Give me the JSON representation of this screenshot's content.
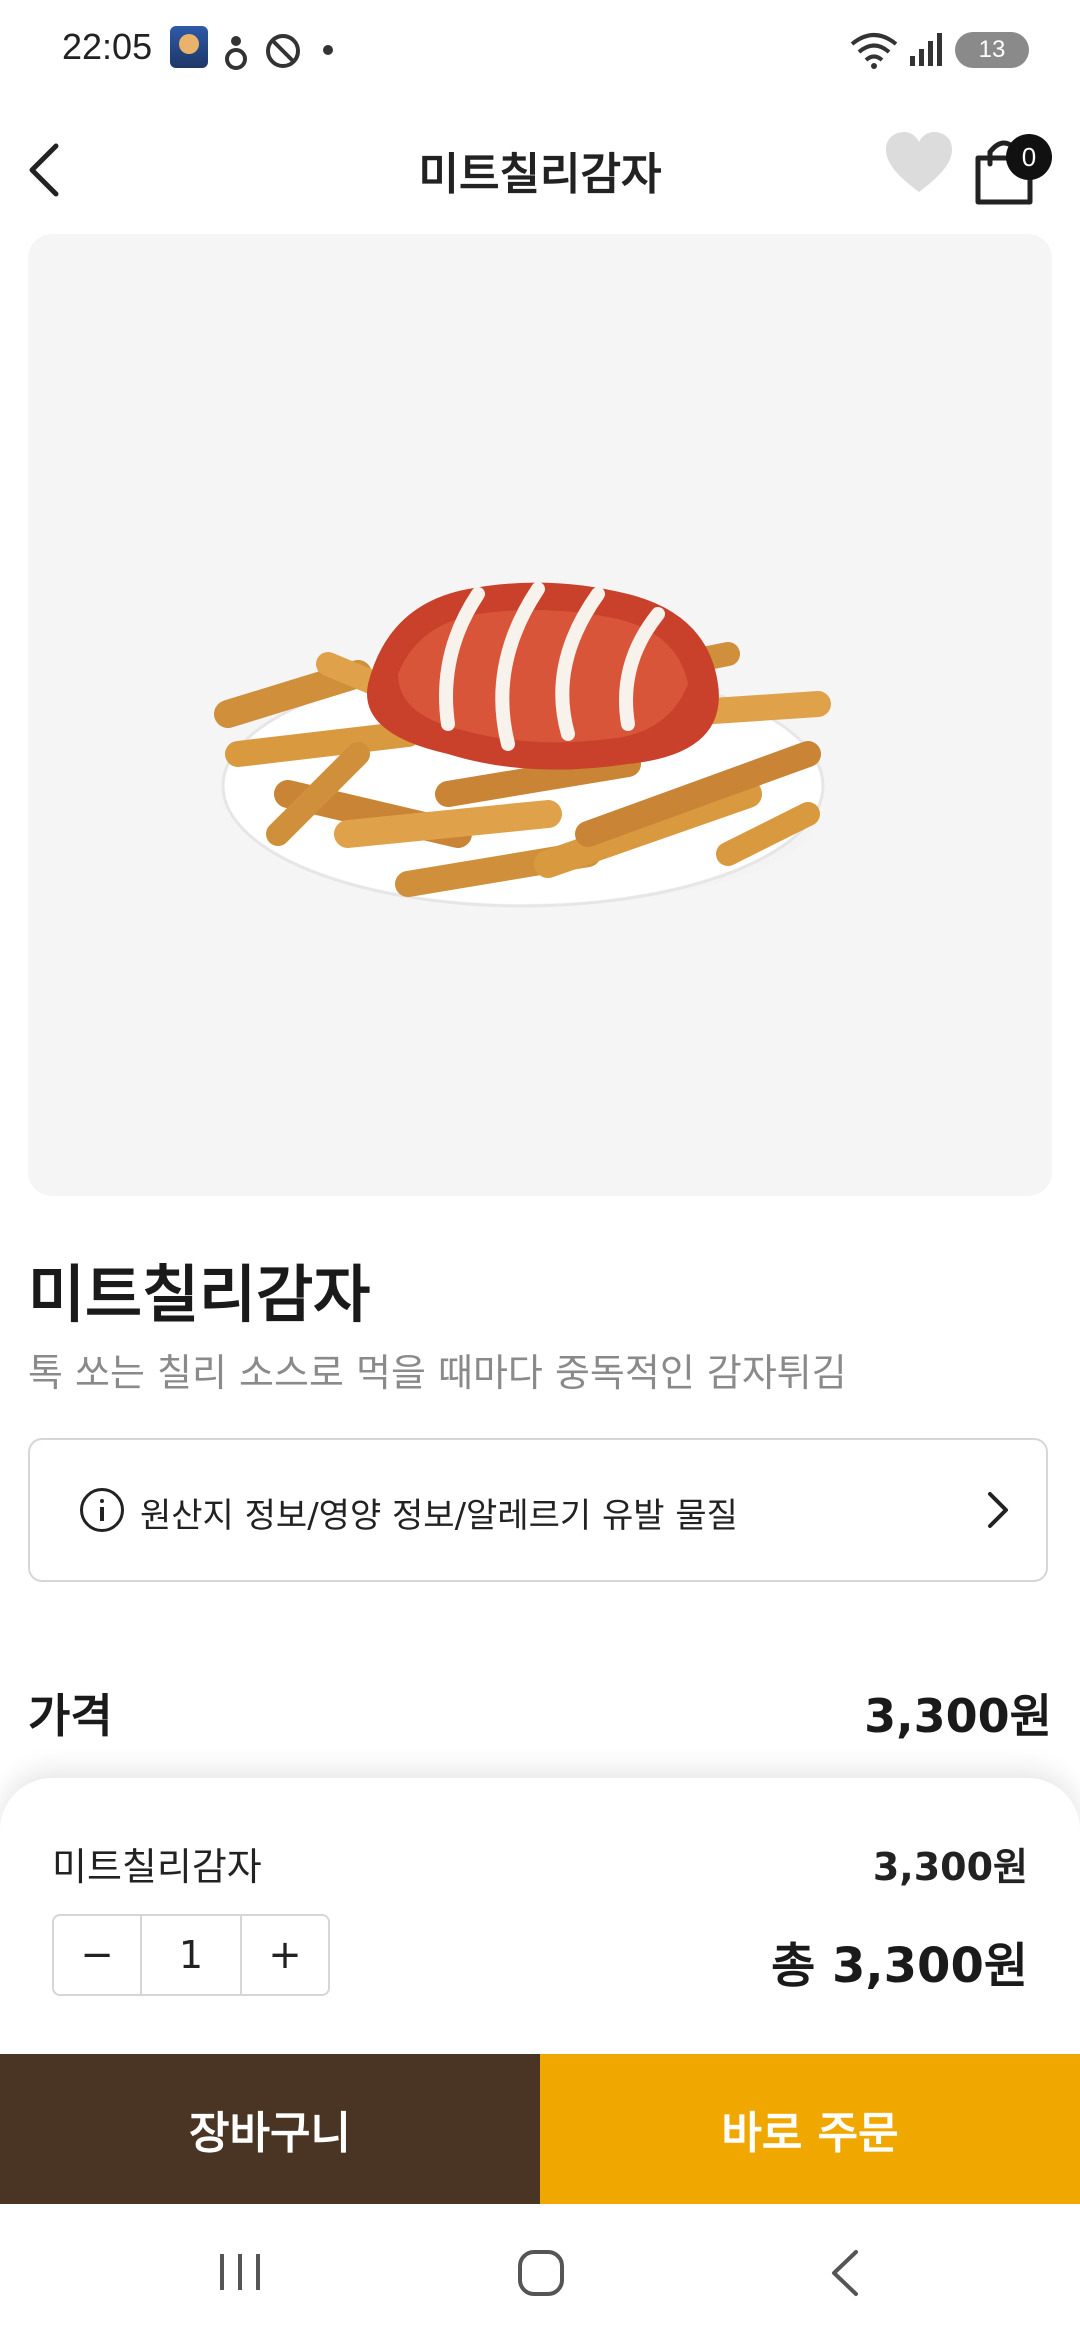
{
  "status_bar": {
    "time": "22:05",
    "battery": "13",
    "icons": [
      "app-avatar-icon",
      "notification-icon",
      "do-not-disturb-icon",
      "wifi-icon",
      "signal-icon",
      "battery-icon"
    ]
  },
  "header": {
    "title": "미트칠리감자",
    "cart_count": "0",
    "icons": [
      "back-arrow-icon",
      "heart-icon",
      "shopping-bag-icon"
    ]
  },
  "product": {
    "image": "fries-with-chili-meat-sauce-photo",
    "name": "미트칠리감자",
    "description": "톡 쏘는 칠리 소스로 먹을 때마다 중독적인 감자튀김",
    "info_label": "원산지 정보/영양 정보/알레르기 유발 물질",
    "price_label": "가격",
    "price": "3,300원"
  },
  "order_sheet": {
    "item_name": "미트칠리감자",
    "item_price": "3,300원",
    "quantity": "1",
    "minus": "−",
    "plus": "+",
    "total": "총 3,300원"
  },
  "actions": {
    "cart_label": "장바구니",
    "order_label": "바로 주문"
  },
  "colors": {
    "cart_button": "#4a3424",
    "order_button": "#f0a800",
    "badge": "#111111"
  }
}
